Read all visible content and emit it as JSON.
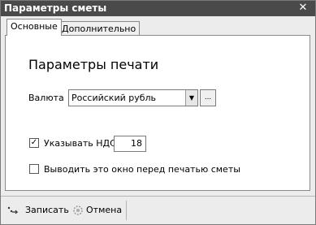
{
  "window": {
    "title": "Параметры сметы",
    "close_glyph": "✕"
  },
  "tabs": [
    {
      "label": "Основные",
      "active": true
    },
    {
      "label": "Дополнительно",
      "active": false
    }
  ],
  "panel": {
    "title": "Параметры печати",
    "currency": {
      "label": "Валюта",
      "selected": "Российский рубль",
      "dropdown_glyph": "▼",
      "browse_label": "..."
    },
    "vat": {
      "checked": true,
      "check_glyph": "✓",
      "label": "Указывать НДС",
      "value": "18"
    },
    "show_before_print": {
      "checked": false,
      "label": "Выводить это окно перед печатью сметы"
    }
  },
  "footer": {
    "save_label": "Записать",
    "save_icon": "save-icon",
    "cancel_label": "Отмена",
    "cancel_icon": "cancel-icon"
  }
}
